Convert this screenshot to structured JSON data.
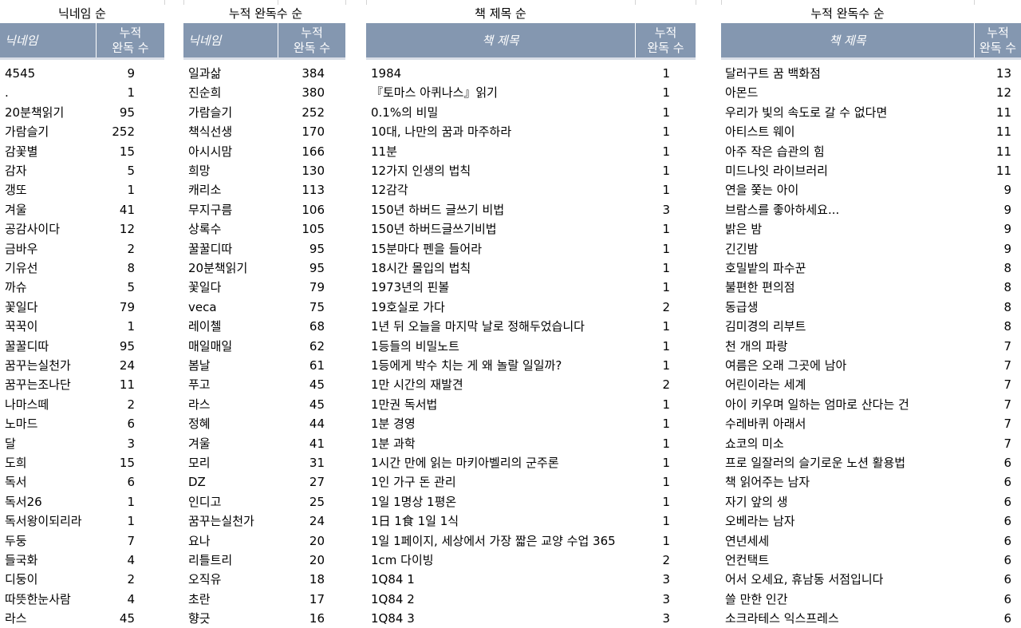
{
  "sections": {
    "nick_sort": "닉네임 순",
    "count_sort_1": "누적 완독수 순",
    "title_sort": "책 제목 순",
    "count_sort_2": "누적 완독수 순"
  },
  "headers": {
    "nickname": "닉네임",
    "book_title": "책 제목",
    "count_line1": "누적",
    "count_line2": "완독 수"
  },
  "table_nick": [
    [
      "4545",
      "9"
    ],
    [
      ".",
      "1"
    ],
    [
      "20분책읽기",
      "95"
    ],
    [
      "가람슬기",
      "252"
    ],
    [
      "감꽃별",
      "15"
    ],
    [
      "감자",
      "5"
    ],
    [
      "갱또",
      "1"
    ],
    [
      "겨울",
      "41"
    ],
    [
      "공감사이다",
      "12"
    ],
    [
      "금바우",
      "2"
    ],
    [
      "기유선",
      "8"
    ],
    [
      "까슈",
      "5"
    ],
    [
      "꽃일다",
      "79"
    ],
    [
      "꾹꾹이",
      "1"
    ],
    [
      "꿀꿀디따",
      "95"
    ],
    [
      "꿈꾸는실천가",
      "24"
    ],
    [
      "꿈꾸는조나단",
      "11"
    ],
    [
      "나마스떼",
      "2"
    ],
    [
      "노마드",
      "6"
    ],
    [
      "달",
      "3"
    ],
    [
      "도희",
      "15"
    ],
    [
      "독서",
      "6"
    ],
    [
      "독서26",
      "1"
    ],
    [
      "독서왕이되리라",
      "1"
    ],
    [
      "두둥",
      "7"
    ],
    [
      "들국화",
      "4"
    ],
    [
      "디둥이",
      "2"
    ],
    [
      "따뜻한눈사람",
      "4"
    ],
    [
      "라스",
      "45"
    ]
  ],
  "table_count1": [
    [
      "일과삶",
      "384"
    ],
    [
      "진순희",
      "380"
    ],
    [
      "가람슬기",
      "252"
    ],
    [
      "책식선생",
      "170"
    ],
    [
      "아시시맘",
      "166"
    ],
    [
      "희망",
      "130"
    ],
    [
      "캐리소",
      "113"
    ],
    [
      "무지구름",
      "106"
    ],
    [
      "상록수",
      "105"
    ],
    [
      "꿀꿀디따",
      "95"
    ],
    [
      "20분책읽기",
      "95"
    ],
    [
      "꽃일다",
      "79"
    ],
    [
      "veca",
      "75"
    ],
    [
      "레이첼",
      "68"
    ],
    [
      "매일매일",
      "62"
    ],
    [
      "봄날",
      "61"
    ],
    [
      "푸고",
      "45"
    ],
    [
      "라스",
      "45"
    ],
    [
      "정혜",
      "44"
    ],
    [
      "겨울",
      "41"
    ],
    [
      "모리",
      "31"
    ],
    [
      "DZ",
      "27"
    ],
    [
      "인디고",
      "25"
    ],
    [
      "꿈꾸는실천가",
      "24"
    ],
    [
      "요나",
      "20"
    ],
    [
      "리틀트리",
      "20"
    ],
    [
      "오직유",
      "18"
    ],
    [
      "초란",
      "17"
    ],
    [
      "향긋",
      "16"
    ]
  ],
  "table_title": [
    [
      "1984",
      "1"
    ],
    [
      "『토마스 아퀴나스』읽기",
      "1"
    ],
    [
      "0.1%의 비밀",
      "1"
    ],
    [
      "10대, 나만의 꿈과 마주하라",
      "1"
    ],
    [
      "11분",
      "1"
    ],
    [
      "12가지 인생의 법칙",
      "1"
    ],
    [
      "12감각",
      "1"
    ],
    [
      "150년 하버드 글쓰기 비법",
      "3"
    ],
    [
      "150년 하버드글쓰기비법",
      "1"
    ],
    [
      "15분마다 펜을 들어라",
      "1"
    ],
    [
      "18시간 몰입의 법칙",
      "1"
    ],
    [
      "1973년의 핀볼",
      "1"
    ],
    [
      "19호실로 가다",
      "2"
    ],
    [
      "1년 뒤 오늘을 마지막 날로 정해두었습니다",
      "1"
    ],
    [
      "1등들의 비밀노트",
      "1"
    ],
    [
      "1등에게 박수 치는 게 왜 놀랄 일일까?",
      "1"
    ],
    [
      "1만 시간의 재발견",
      "2"
    ],
    [
      "1만권 독서법",
      "1"
    ],
    [
      "1분 경영",
      "1"
    ],
    [
      "1분 과학",
      "1"
    ],
    [
      "1시간 만에 읽는 마키아벨리의 군주론",
      "1"
    ],
    [
      "1인 가구 돈 관리",
      "1"
    ],
    [
      "1일 1명상 1평온",
      "1"
    ],
    [
      "1日 1食 1일 1식",
      "1"
    ],
    [
      "1일 1페이지, 세상에서 가장 짧은 교양 수업 365",
      "1"
    ],
    [
      "1cm 다이빙",
      "2"
    ],
    [
      "1Q84 1",
      "3"
    ],
    [
      "1Q84 2",
      "3"
    ],
    [
      "1Q84 3",
      "3"
    ]
  ],
  "table_count2": [
    [
      "달러구트 꿈 백화점",
      "13"
    ],
    [
      "아몬드",
      "12"
    ],
    [
      "우리가 빛의 속도로 갈 수 없다면",
      "11"
    ],
    [
      "아티스트 웨이",
      "11"
    ],
    [
      "아주 작은 습관의 힘",
      "11"
    ],
    [
      "미드나잇 라이브러리",
      "11"
    ],
    [
      "연을 쫓는 아이",
      "9"
    ],
    [
      "브람스를 좋아하세요...",
      "9"
    ],
    [
      "밝은 밤",
      "9"
    ],
    [
      "긴긴밤",
      "9"
    ],
    [
      "호밀밭의 파수꾼",
      "8"
    ],
    [
      "불편한 편의점",
      "8"
    ],
    [
      "동급생",
      "8"
    ],
    [
      "김미경의 리부트",
      "8"
    ],
    [
      "천 개의 파랑",
      "7"
    ],
    [
      "여름은 오래 그곳에 남아",
      "7"
    ],
    [
      "어린이라는 세계",
      "7"
    ],
    [
      "아이 키우며 일하는 엄마로 산다는 건",
      "7"
    ],
    [
      "수레바퀴 아래서",
      "7"
    ],
    [
      "쇼코의 미소",
      "7"
    ],
    [
      "프로 일잘러의 슬기로운 노션 활용법",
      "6"
    ],
    [
      "책 읽어주는 남자",
      "6"
    ],
    [
      "자기 앞의 생",
      "6"
    ],
    [
      "오베라는 남자",
      "6"
    ],
    [
      "연년세세",
      "6"
    ],
    [
      "언컨택트",
      "6"
    ],
    [
      "어서 오세요, 휴남동 서점입니다",
      "6"
    ],
    [
      "쓸 만한 인간",
      "6"
    ],
    [
      "소크라테스 익스프레스",
      "6"
    ]
  ],
  "colors": {
    "header_bg": "#8497b0",
    "header_text": "#ffffff"
  }
}
